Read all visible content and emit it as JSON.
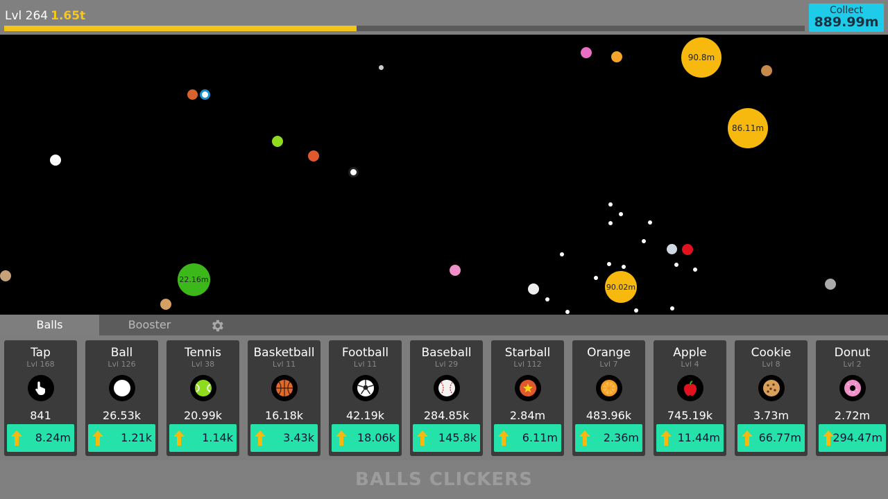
{
  "header": {
    "level_label": "Lvl 264",
    "money": "1.65t",
    "progress": 0.44,
    "collect_label": "Collect",
    "collect_value": "889.99m"
  },
  "field": {
    "big_balls": [
      {
        "label": "90.8m",
        "color": "#f7b90e"
      },
      {
        "label": "86.11m",
        "color": "#f7b90e"
      },
      {
        "label": "22.16m",
        "color": "#3db81b"
      },
      {
        "label": "90.02m",
        "color": "#f7b90e"
      }
    ]
  },
  "tabs": {
    "balls": "Balls",
    "booster": "Booster",
    "settings_icon": "gear-icon"
  },
  "cards": [
    {
      "name": "Tap",
      "level": "Lvl 168",
      "value": "841",
      "cost": "8.24m",
      "icon": "hand-pointer-icon"
    },
    {
      "name": "Ball",
      "level": "Lvl 126",
      "value": "26.53k",
      "cost": "1.21k",
      "icon": "white-ball-icon"
    },
    {
      "name": "Tennis",
      "level": "Lvl 38",
      "value": "20.99k",
      "cost": "1.14k",
      "icon": "tennis-ball-icon"
    },
    {
      "name": "Basketball",
      "level": "Lvl 11",
      "value": "16.18k",
      "cost": "3.43k",
      "icon": "basketball-icon"
    },
    {
      "name": "Football",
      "level": "Lvl 11",
      "value": "42.19k",
      "cost": "18.06k",
      "icon": "soccer-ball-icon"
    },
    {
      "name": "Baseball",
      "level": "Lvl 29",
      "value": "284.85k",
      "cost": "145.8k",
      "icon": "baseball-icon"
    },
    {
      "name": "Starball",
      "level": "Lvl 112",
      "value": "2.84m",
      "cost": "6.11m",
      "icon": "star-ball-icon"
    },
    {
      "name": "Orange",
      "level": "Lvl 7",
      "value": "483.96k",
      "cost": "2.36m",
      "icon": "orange-icon"
    },
    {
      "name": "Apple",
      "level": "Lvl 4",
      "value": "745.19k",
      "cost": "11.44m",
      "icon": "apple-icon"
    },
    {
      "name": "Cookie",
      "level": "Lvl 8",
      "value": "3.73m",
      "cost": "66.77m",
      "icon": "cookie-icon"
    },
    {
      "name": "Donut",
      "level": "Lvl 2",
      "value": "2.72m",
      "cost": "294.47m",
      "icon": "donut-icon"
    }
  ],
  "footer": {
    "title": "BALLS CLICKERS"
  },
  "colors": {
    "accent_green": "#24e2a9",
    "collect_cyan": "#1ecbe9",
    "gold": "#f7c81b"
  }
}
